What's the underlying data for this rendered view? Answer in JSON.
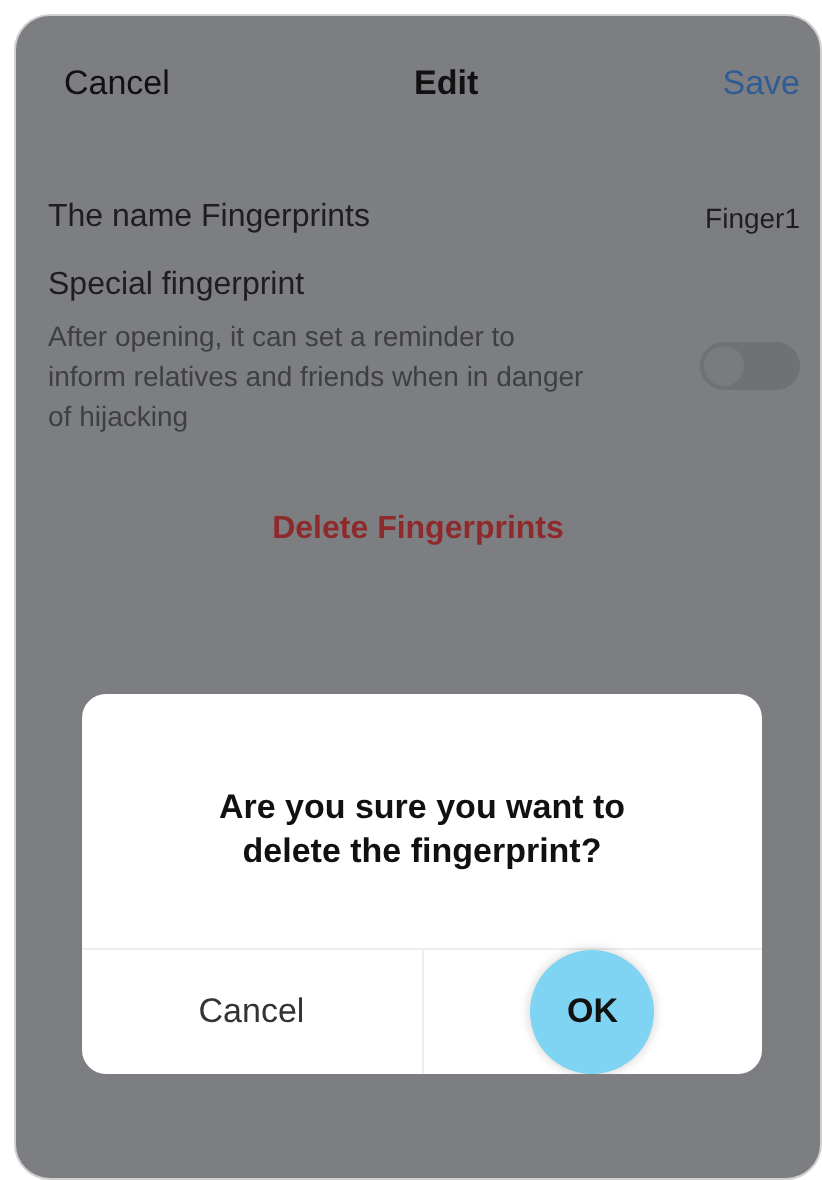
{
  "header": {
    "cancel": "Cancel",
    "title": "Edit",
    "save": "Save"
  },
  "name_row": {
    "label": "The name Fingerprints",
    "value": "Finger1"
  },
  "special": {
    "label": "Special fingerprint",
    "description": "After opening, it can set a reminder to inform relatives and friends when in danger of hijacking",
    "on": false
  },
  "delete_button": "Delete Fingerprints",
  "dialog": {
    "message": "Are you sure you want to delete the fingerprint?",
    "buttons": [
      {
        "label": "Cancel",
        "kind": "cancel",
        "pressed": false
      },
      {
        "label": "OK",
        "kind": "confirm",
        "pressed": true
      }
    ]
  }
}
